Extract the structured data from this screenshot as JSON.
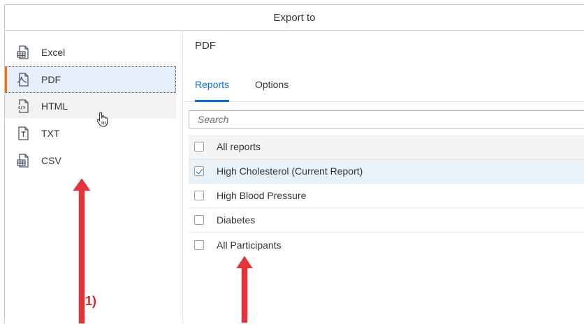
{
  "dialog": {
    "title": "Export to"
  },
  "sidebar": {
    "items": [
      {
        "label": "Excel",
        "icon": "spreadsheet-file-icon"
      },
      {
        "label": "PDF",
        "icon": "pdf-file-icon",
        "selected": true
      },
      {
        "label": "HTML",
        "icon": "html-file-icon",
        "hovered": true
      },
      {
        "label": "TXT",
        "icon": "text-file-icon"
      },
      {
        "label": "CSV",
        "icon": "spreadsheet-file-icon"
      }
    ]
  },
  "main": {
    "heading": "PDF",
    "tabs": [
      {
        "label": "Reports",
        "active": true
      },
      {
        "label": "Options",
        "active": false
      }
    ],
    "search": {
      "placeholder": "Search",
      "value": ""
    },
    "reports": [
      {
        "label": "All reports",
        "checked": false
      },
      {
        "label": "High Cholesterol (Current Report)",
        "checked": true
      },
      {
        "label": "High Blood Pressure",
        "checked": false
      },
      {
        "label": "Diabetes",
        "checked": false
      },
      {
        "label": "All Participants",
        "checked": false
      }
    ]
  },
  "annotations": {
    "label_1": "1)"
  },
  "colors": {
    "accent": "#0a6ed1",
    "selection_marker": "#e9730c",
    "annotation": "#e0353b"
  }
}
